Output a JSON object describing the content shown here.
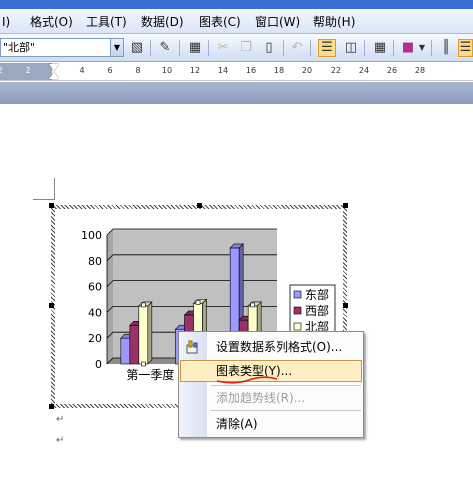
{
  "menubar": {
    "items": [
      {
        "label": "I)"
      },
      {
        "label": "格式(O)"
      },
      {
        "label": "工具(T)"
      },
      {
        "label": "数据(D)"
      },
      {
        "label": "图表(C)"
      },
      {
        "label": "窗口(W)"
      },
      {
        "label": "帮助(H)"
      }
    ]
  },
  "toolbar": {
    "combo_value": "\"北部\"",
    "combo_arrow": "▼"
  },
  "ruler": {
    "ticks": [
      "2",
      "2",
      "4",
      "6",
      "8",
      "10",
      "12",
      "14",
      "16",
      "18",
      "20",
      "22",
      "24",
      "26",
      "28"
    ]
  },
  "document": {
    "para_marks": [
      "↵",
      "↵"
    ]
  },
  "chart_data": {
    "type": "bar",
    "categories": [
      "第一季度",
      "",
      ""
    ],
    "series": [
      {
        "name": "东部",
        "values": [
          20,
          27,
          90
        ]
      },
      {
        "name": "西部",
        "values": [
          30,
          38,
          34
        ]
      },
      {
        "name": "北部",
        "values": [
          45,
          47,
          45
        ]
      }
    ],
    "ylim": [
      0,
      100
    ],
    "yticks": [
      "0",
      "20",
      "40",
      "60",
      "80",
      "100"
    ],
    "colors": {
      "东部": "#9999ff",
      "西部": "#993366",
      "北部": "#ffffcc",
      "plot_bg": "#c0c0c0"
    },
    "legend_position": "right",
    "grid": true
  },
  "context_menu": {
    "items": [
      {
        "label": "设置数据系列格式(O)...",
        "icon": "format-series-icon"
      },
      {
        "label": "图表类型(Y)..."
      },
      {
        "label": "添加趋势线(R)..."
      },
      {
        "label": "清除(A)"
      }
    ]
  }
}
